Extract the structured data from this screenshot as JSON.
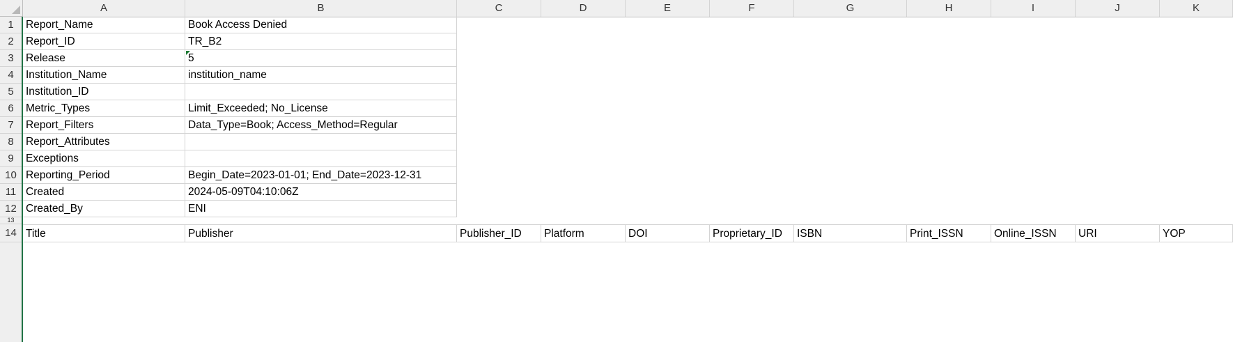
{
  "columns": [
    "A",
    "B",
    "C",
    "D",
    "E",
    "F",
    "G",
    "H",
    "I",
    "J",
    "K"
  ],
  "row_numbers": [
    "1",
    "2",
    "3",
    "4",
    "5",
    "6",
    "7",
    "8",
    "9",
    "10",
    "11",
    "12",
    "13",
    "14"
  ],
  "metadata_rows": [
    {
      "label": "Report_Name",
      "value": "Book Access Denied"
    },
    {
      "label": "Report_ID",
      "value": "TR_B2"
    },
    {
      "label": "Release",
      "value": "5"
    },
    {
      "label": "Institution_Name",
      "value": "institution_name"
    },
    {
      "label": "Institution_ID",
      "value": ""
    },
    {
      "label": "Metric_Types",
      "value": "Limit_Exceeded; No_License"
    },
    {
      "label": "Report_Filters",
      "value": "Data_Type=Book; Access_Method=Regular"
    },
    {
      "label": "Report_Attributes",
      "value": ""
    },
    {
      "label": "Exceptions",
      "value": ""
    },
    {
      "label": "Reporting_Period",
      "value": "Begin_Date=2023-01-01; End_Date=2023-12-31"
    },
    {
      "label": "Created",
      "value": "2024-05-09T04:10:06Z"
    },
    {
      "label": "Created_By",
      "value": "ENI"
    }
  ],
  "header_row": [
    "Title",
    "Publisher",
    "Publisher_ID",
    "Platform",
    "DOI",
    "Proprietary_ID",
    "ISBN",
    "Print_ISSN",
    "Online_ISSN",
    "URI",
    "YOP"
  ]
}
